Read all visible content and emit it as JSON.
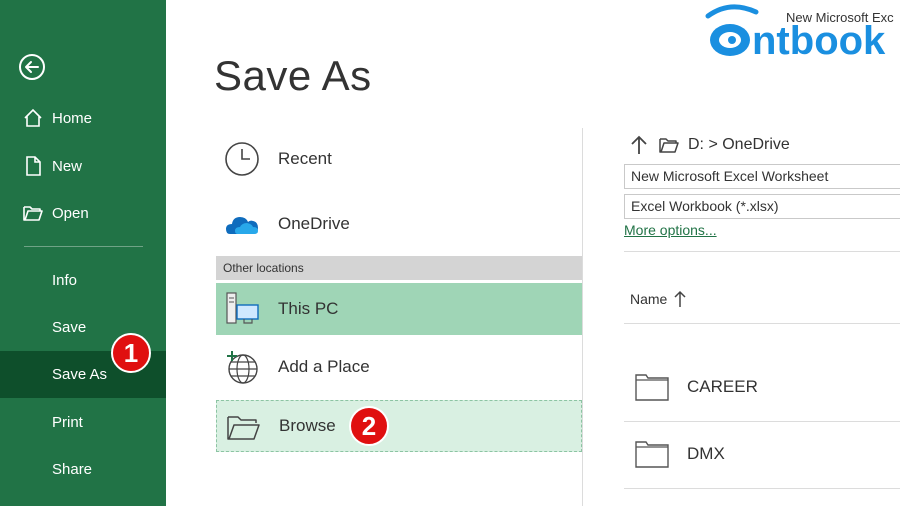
{
  "window": {
    "filename": "New Microsoft Exc"
  },
  "watermark": {
    "text": "ntbook",
    "color": "#1a8fe0"
  },
  "sidebar": {
    "bg": "#217346",
    "active_bg": "#0e4f2b",
    "items": [
      {
        "label": "Home",
        "icon": "home-icon"
      },
      {
        "label": "New",
        "icon": "new-document-icon"
      },
      {
        "label": "Open",
        "icon": "open-folder-icon"
      },
      {
        "label": "Info"
      },
      {
        "label": "Save"
      },
      {
        "label": "Save As",
        "active": true
      },
      {
        "label": "Print"
      },
      {
        "label": "Share"
      }
    ]
  },
  "badges": {
    "first": "1",
    "second": "2",
    "color": "#e01010"
  },
  "main": {
    "title": "Save As",
    "locations": [
      {
        "label": "Recent",
        "icon": "clock-icon"
      },
      {
        "label": "OneDrive",
        "icon": "cloud-icon"
      }
    ],
    "other_locations_header": "Other locations",
    "other_locations": [
      {
        "label": "This PC",
        "icon": "pc-icon",
        "selected": true
      },
      {
        "label": "Add a Place",
        "icon": "globe-plus-icon"
      },
      {
        "label": "Browse",
        "icon": "folder-open-icon"
      }
    ]
  },
  "right": {
    "path": "D: > OneDrive",
    "filename_value": "New Microsoft Excel Worksheet",
    "filetype_value": "Excel Workbook (*.xlsx)",
    "more_options": "More options...",
    "column_name": "Name",
    "folders": [
      "CAREER",
      "DMX"
    ]
  }
}
